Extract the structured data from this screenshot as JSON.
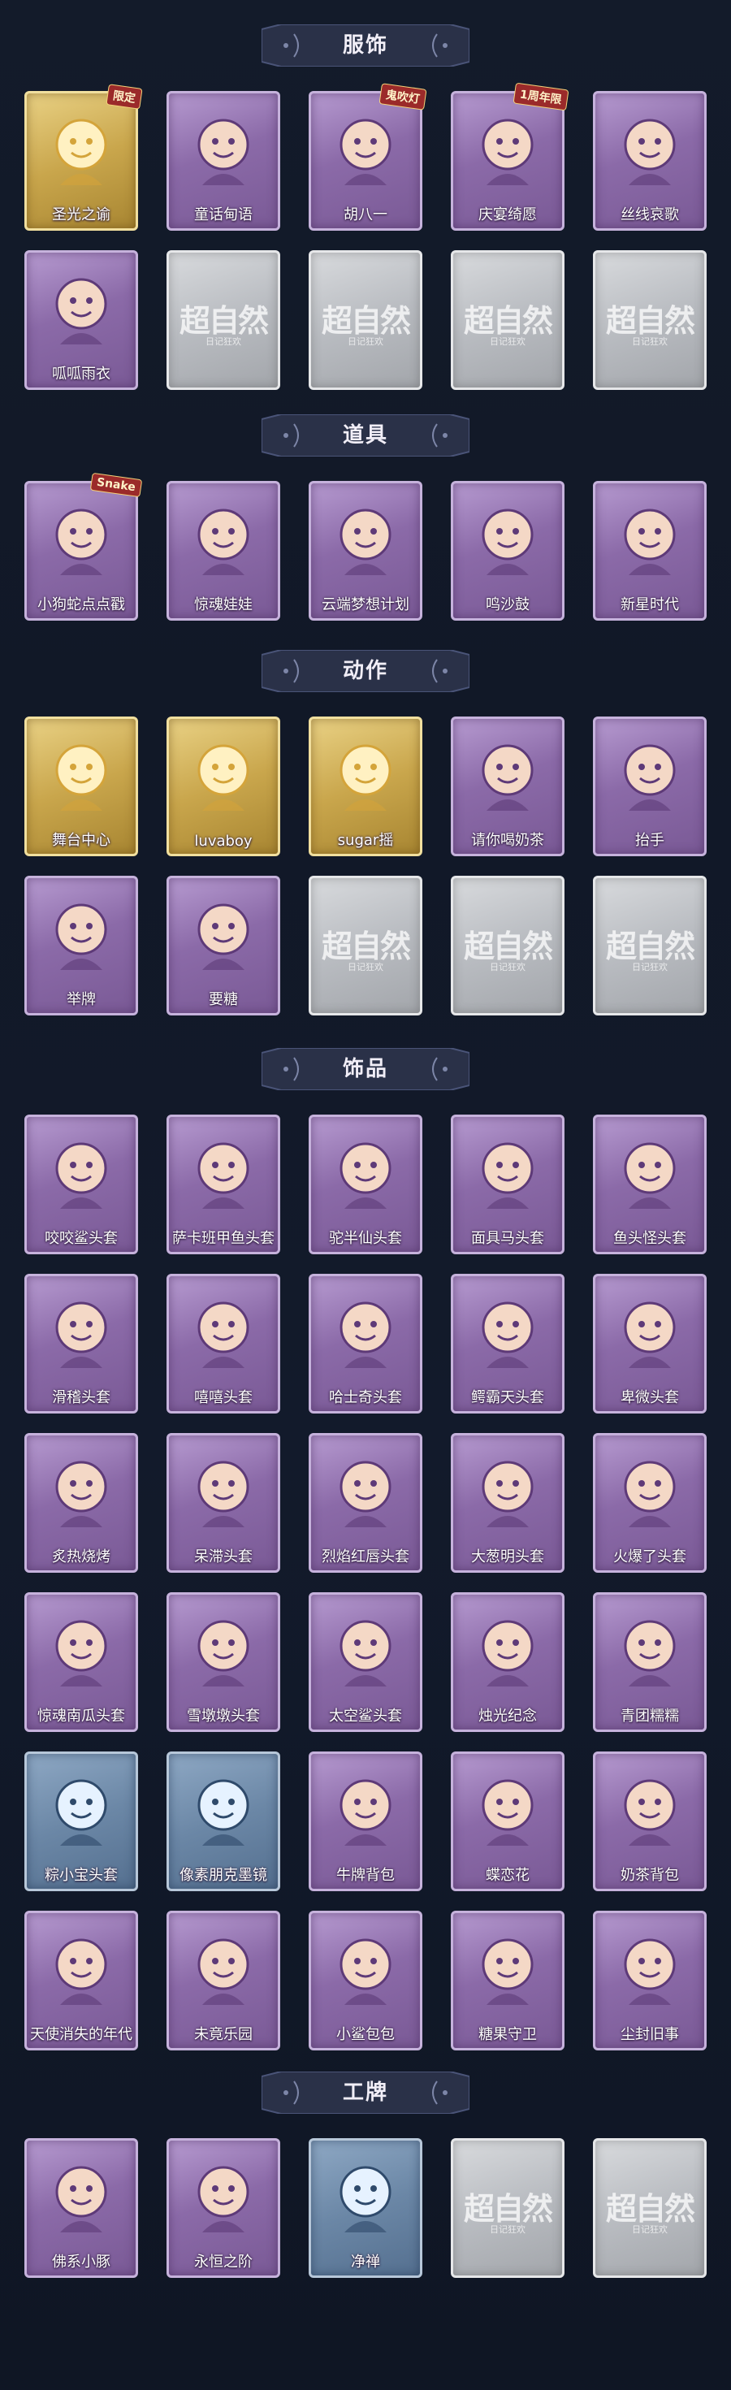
{
  "theme": {
    "background": "#111827",
    "card_purple": "#8b6aa8",
    "card_gold": "#c9a64c",
    "card_silver": "#b9bcc1",
    "card_blue": "#6b87a6",
    "header_bg": "#2a3148"
  },
  "placeholder": {
    "watermark": "超自然",
    "subtitle": "日记狂欢"
  },
  "sections": [
    {
      "title": "服饰",
      "items": [
        {
          "label": "圣光之谕",
          "rarity": "gold",
          "icon": "portrait-blonde-icon",
          "badge": "限定"
        },
        {
          "label": "童话甸语",
          "rarity": "purple",
          "icon": "portrait-red-hair-icon"
        },
        {
          "label": "胡八一",
          "rarity": "purple",
          "icon": "portrait-gray-hair-icon",
          "badge": "鬼吹灯"
        },
        {
          "label": "庆宴绮愿",
          "rarity": "purple",
          "icon": "portrait-cake-hat-icon",
          "badge": "1周年限"
        },
        {
          "label": "丝线哀歌",
          "rarity": "purple",
          "icon": "portrait-doll-icon"
        },
        {
          "label": "呱呱雨衣",
          "rarity": "purple",
          "icon": "portrait-frog-hood-icon"
        },
        {
          "label": "",
          "rarity": "silver",
          "icon": "placeholder-icon"
        },
        {
          "label": "",
          "rarity": "silver",
          "icon": "placeholder-icon"
        },
        {
          "label": "",
          "rarity": "silver",
          "icon": "placeholder-icon"
        },
        {
          "label": "",
          "rarity": "silver",
          "icon": "placeholder-icon"
        }
      ]
    },
    {
      "title": "道具",
      "items": [
        {
          "label": "小狗蛇点点戳",
          "rarity": "purple",
          "icon": "snake-toy-icon",
          "badge": "Snake"
        },
        {
          "label": "惊魂娃娃",
          "rarity": "purple",
          "icon": "skull-doll-icon"
        },
        {
          "label": "云端梦想计划",
          "rarity": "purple",
          "icon": "wand-icon"
        },
        {
          "label": "鸣沙鼓",
          "rarity": "purple",
          "icon": "drum-icon"
        },
        {
          "label": "新星时代",
          "rarity": "purple",
          "icon": "revolver-icon"
        }
      ]
    },
    {
      "title": "动作",
      "items": [
        {
          "label": "舞台中心",
          "rarity": "gold",
          "icon": "dance-pose-icon"
        },
        {
          "label": "luvaboy",
          "rarity": "gold",
          "icon": "dance-pose-icon"
        },
        {
          "label": "sugar摇",
          "rarity": "gold",
          "icon": "dance-pose-icon"
        },
        {
          "label": "请你喝奶茶",
          "rarity": "purple",
          "icon": "milk-tea-pose-icon"
        },
        {
          "label": "抬手",
          "rarity": "purple",
          "icon": "raise-hand-icon"
        },
        {
          "label": "举牌",
          "rarity": "purple",
          "icon": "hold-sign-icon"
        },
        {
          "label": "要糖",
          "rarity": "purple",
          "icon": "ask-candy-icon"
        },
        {
          "label": "",
          "rarity": "silver",
          "icon": "placeholder-icon"
        },
        {
          "label": "",
          "rarity": "silver",
          "icon": "placeholder-icon"
        },
        {
          "label": "",
          "rarity": "silver",
          "icon": "placeholder-icon"
        }
      ]
    },
    {
      "title": "饰品",
      "items": [
        {
          "label": "咬咬鲨头套",
          "rarity": "purple",
          "icon": "shark-head-icon"
        },
        {
          "label": "萨卡班甲鱼头套",
          "rarity": "purple",
          "icon": "fish-head-icon"
        },
        {
          "label": "驼半仙头套",
          "rarity": "purple",
          "icon": "bear-head-icon"
        },
        {
          "label": "面具马头套",
          "rarity": "purple",
          "icon": "horse-head-icon"
        },
        {
          "label": "鱼头怪头套",
          "rarity": "purple",
          "icon": "green-fish-icon"
        },
        {
          "label": "滑稽头套",
          "rarity": "purple",
          "icon": "smile-emoji-icon"
        },
        {
          "label": "嘻嘻头套",
          "rarity": "purple",
          "icon": "grin-emoji-icon"
        },
        {
          "label": "哈士奇头套",
          "rarity": "purple",
          "icon": "husky-head-icon"
        },
        {
          "label": "鳄霸天头套",
          "rarity": "purple",
          "icon": "crocodile-head-icon"
        },
        {
          "label": "卑微头套",
          "rarity": "purple",
          "icon": "pleading-emoji-icon"
        },
        {
          "label": "炙热烧烤",
          "rarity": "purple",
          "icon": "bbq-monster-icon"
        },
        {
          "label": "呆滞头套",
          "rarity": "purple",
          "icon": "dazed-emoji-icon"
        },
        {
          "label": "烈焰红唇头套",
          "rarity": "purple",
          "icon": "pikachu-head-icon"
        },
        {
          "label": "大葱明头套",
          "rarity": "purple",
          "icon": "bok-choy-icon"
        },
        {
          "label": "火爆了头套",
          "rarity": "purple",
          "icon": "fire-spirit-icon"
        },
        {
          "label": "惊魂南瓜头套",
          "rarity": "purple",
          "icon": "pumpkin-icon"
        },
        {
          "label": "雪墩墩头套",
          "rarity": "purple",
          "icon": "snowman-icon"
        },
        {
          "label": "太空鲨头套",
          "rarity": "purple",
          "icon": "space-shark-icon"
        },
        {
          "label": "烛光纪念",
          "rarity": "purple",
          "icon": "candle-icon"
        },
        {
          "label": "青团糯糯",
          "rarity": "purple",
          "icon": "green-dumpling-icon"
        },
        {
          "label": "粽小宝头套",
          "rarity": "blue",
          "icon": "zongzi-icon"
        },
        {
          "label": "像素朋克墨镜",
          "rarity": "blue",
          "icon": "pixel-glasses-icon"
        },
        {
          "label": "牛牌背包",
          "rarity": "purple",
          "icon": "cow-backpack-icon"
        },
        {
          "label": "蝶恋花",
          "rarity": "purple",
          "icon": "butterfly-ornament-icon"
        },
        {
          "label": "奶茶背包",
          "rarity": "purple",
          "icon": "milk-tea-backpack-icon"
        },
        {
          "label": "天使消失的年代",
          "rarity": "purple",
          "icon": "angel-doll-icon"
        },
        {
          "label": "未竟乐园",
          "rarity": "purple",
          "icon": "bunny-girl-icon"
        },
        {
          "label": "小鲨包包",
          "rarity": "purple",
          "icon": "shark-bag-icon"
        },
        {
          "label": "糖果守卫",
          "rarity": "purple",
          "icon": "candy-guard-icon"
        },
        {
          "label": "尘封旧事",
          "rarity": "purple",
          "icon": "chibi-gentleman-icon"
        }
      ]
    },
    {
      "title": "工牌",
      "items": [
        {
          "label": "佛系小豚",
          "rarity": "purple",
          "icon": "gold-frame-icon"
        },
        {
          "label": "永恒之阶",
          "rarity": "purple",
          "icon": "glow-frame-icon"
        },
        {
          "label": "净禅",
          "rarity": "blue",
          "icon": "portrait-card-icon"
        },
        {
          "label": "",
          "rarity": "silver",
          "icon": "placeholder-icon"
        },
        {
          "label": "",
          "rarity": "silver",
          "icon": "placeholder-icon"
        }
      ]
    }
  ]
}
